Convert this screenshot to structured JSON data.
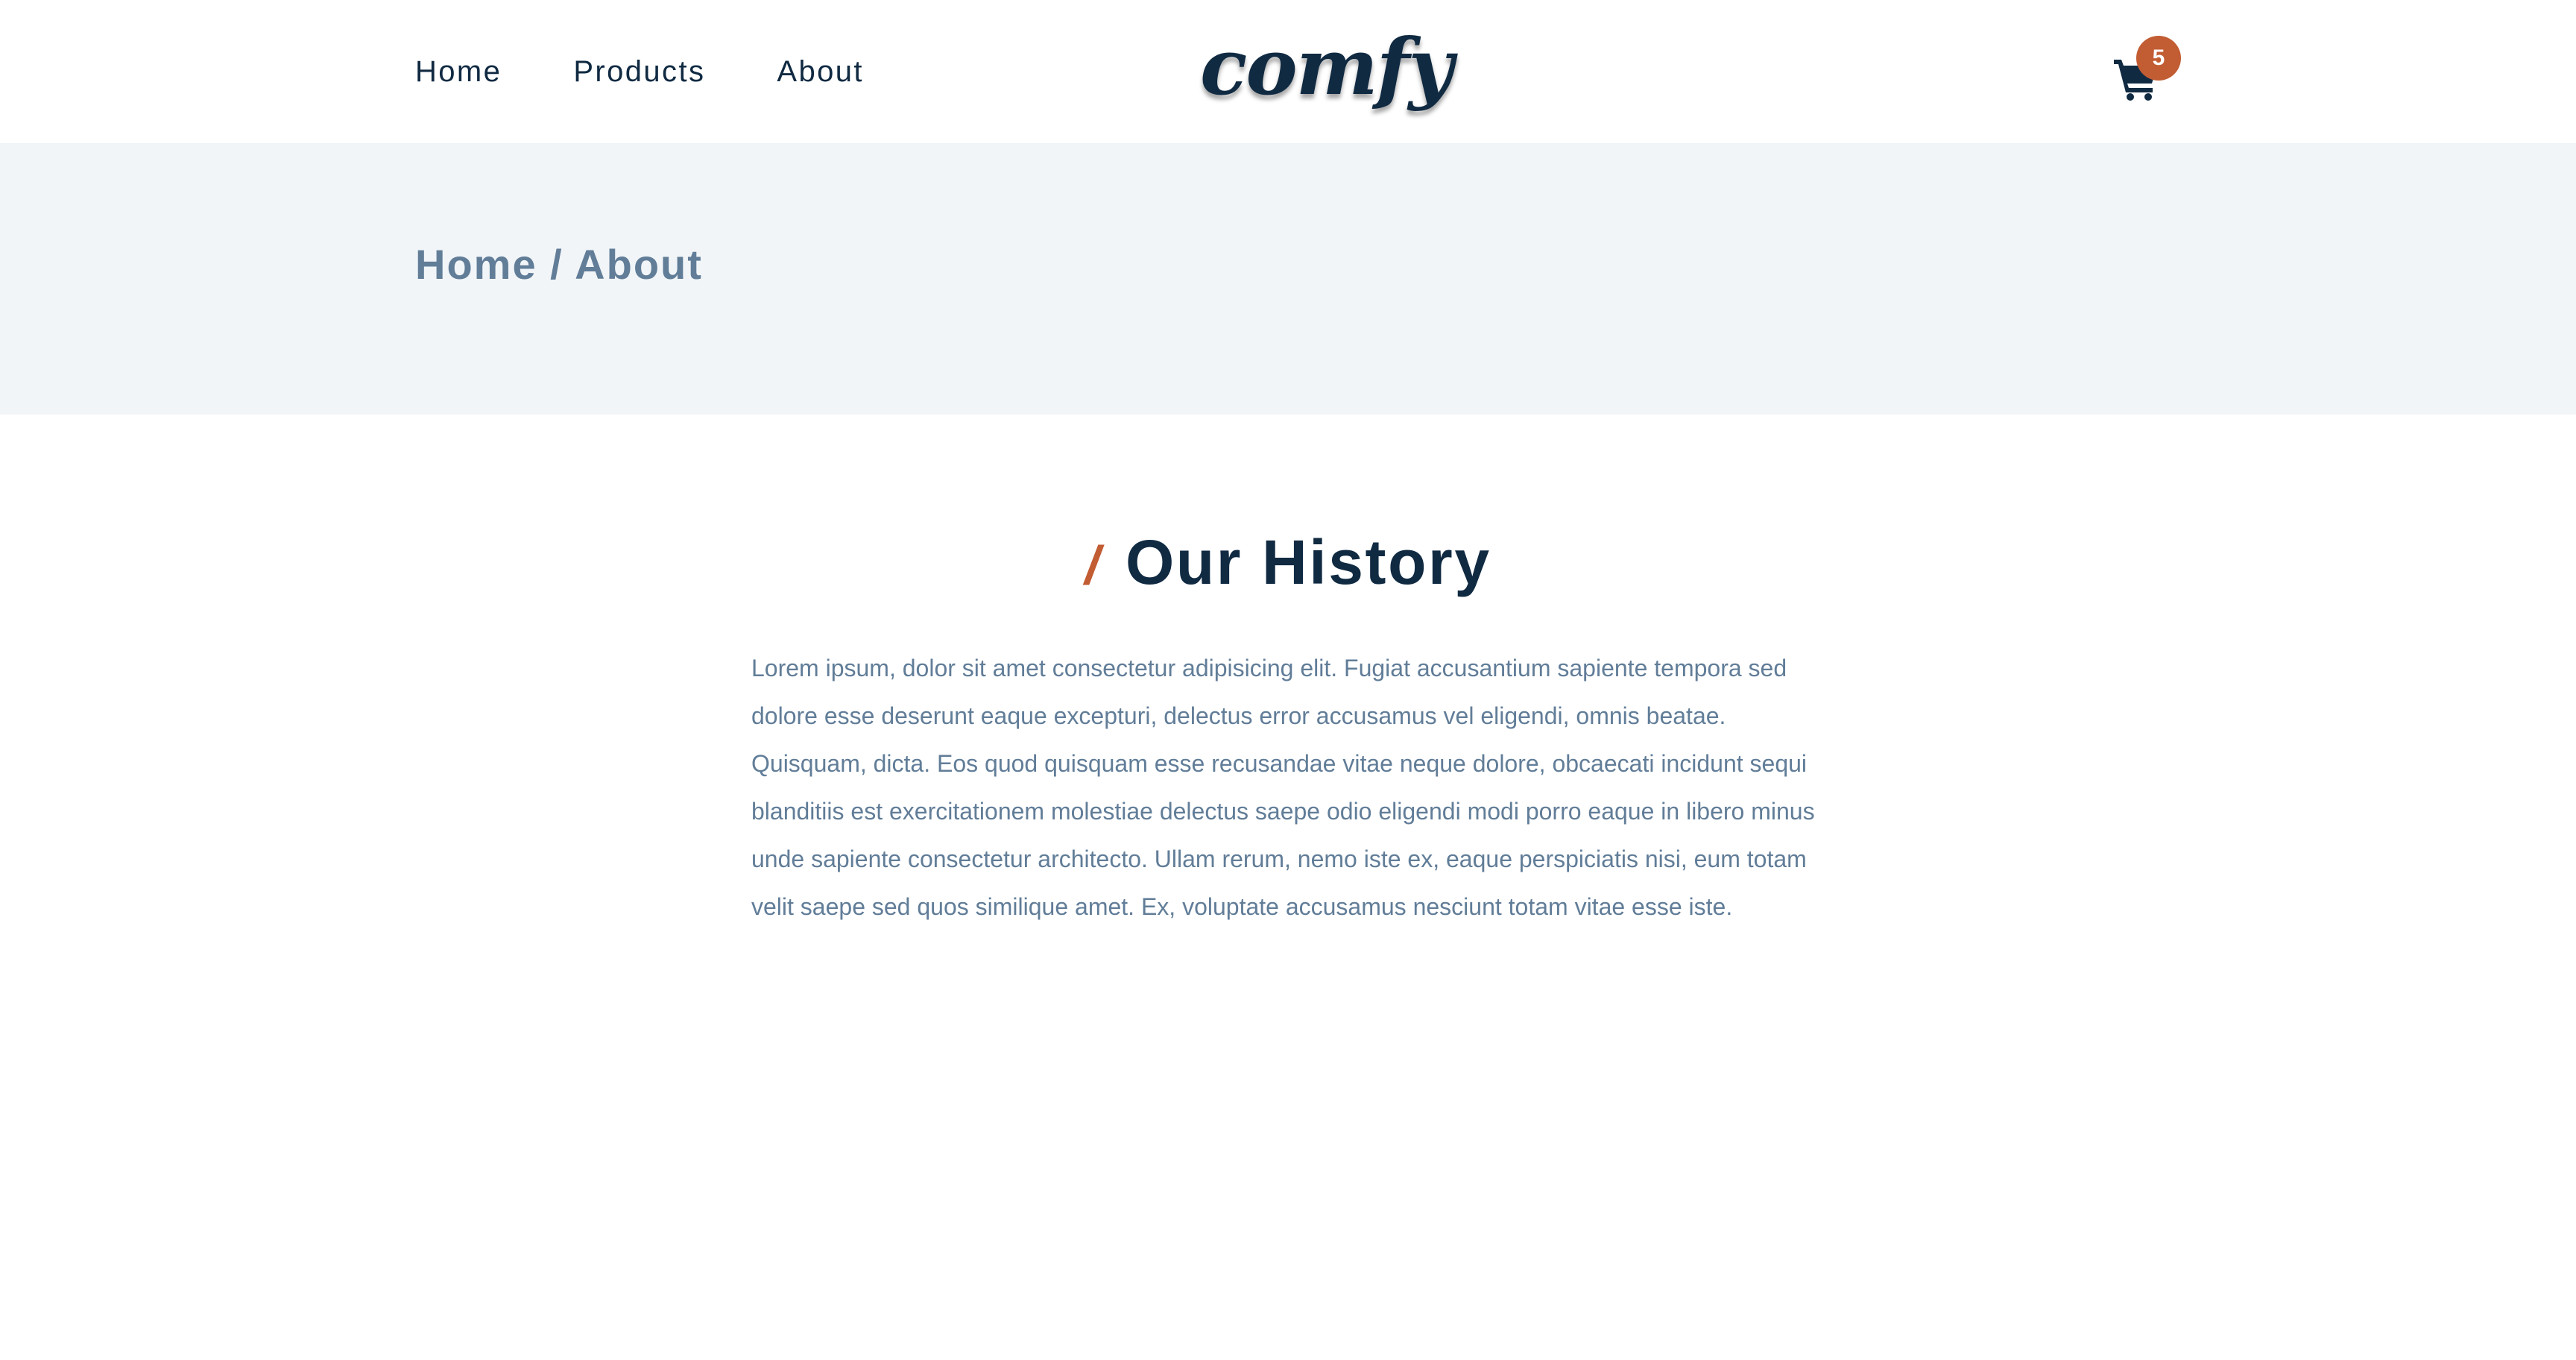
{
  "navbar": {
    "links": [
      {
        "label": "Home"
      },
      {
        "label": "Products"
      },
      {
        "label": "About"
      }
    ],
    "logo": "comfy",
    "cart": {
      "icon": "shopping-cart-icon",
      "count": "5"
    }
  },
  "hero": {
    "breadcrumb": "Home / About"
  },
  "history": {
    "slash": "/",
    "title": "Our History",
    "text": "Lorem ipsum, dolor sit amet consectetur adipisicing elit. Fugiat accusantium sapiente tempora sed dolore esse deserunt eaque excepturi, delectus error accusamus vel eligendi, omnis beatae. Quisquam, dicta. Eos quod quisquam esse recusandae vitae neque dolore, obcaecati incidunt sequi blanditiis est exercitationem molestiae delectus saepe odio eligendi modi porro eaque in libero minus unde sapiente consectetur architecto. Ullam rerum, nemo iste ex, eaque perspiciatis nisi, eum totam velit saepe sed quos similique amet. Ex, voluptate accusamus nesciunt totam vitae esse iste."
  },
  "colors": {
    "primary_dark": "#102a42",
    "muted": "#617d98",
    "accent": "#c25c33",
    "hero_bg": "#f1f5f8"
  }
}
